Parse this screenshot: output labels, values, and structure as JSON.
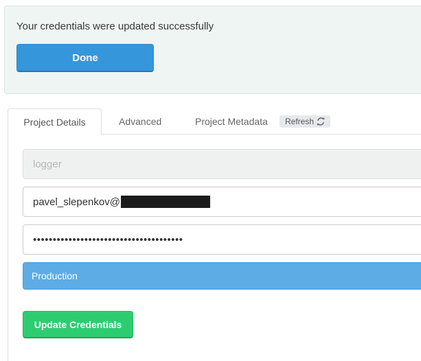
{
  "alert": {
    "message": "Your credentials were updated successfully",
    "done_label": "Done",
    "accent_color": "#3596dc"
  },
  "tabs": {
    "items": [
      {
        "label": "Project Details",
        "active": true
      },
      {
        "label": "Advanced",
        "active": false
      },
      {
        "label": "Project Metadata",
        "active": false
      }
    ],
    "refresh_label": "Refresh",
    "refresh_icon": "refresh-icon"
  },
  "form": {
    "project_value": "logger",
    "email_value": "pavel_slepenkov@",
    "email_redacted": true,
    "password_mask": "••••••••••••••••••••••••••••••••••••••",
    "environment_selected": "Production",
    "update_label": "Update Credentials",
    "update_color": "#2ecc71",
    "environment_color": "#5dace6"
  }
}
